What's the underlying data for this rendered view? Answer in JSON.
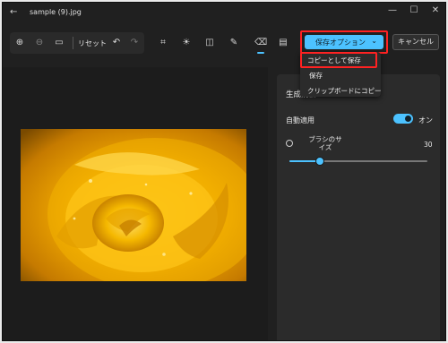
{
  "window": {
    "title": "sample (9).jpg",
    "back_glyph": "←",
    "minimize_glyph": "—",
    "maximize_glyph": "☐",
    "close_glyph": "✕"
  },
  "toolbar": {
    "reset_label": "リセット",
    "zoom_in_glyph": "⊕",
    "zoom_out_glyph": "⊖",
    "fit_glyph": "▭",
    "undo_glyph": "↶",
    "redo_glyph": "↷",
    "crop_glyph": "⌗",
    "adjust_glyph": "☀",
    "filter_glyph": "◫",
    "markup_glyph": "✎",
    "erase_glyph": "⌫",
    "more_glyph": "▤"
  },
  "save": {
    "label": "保存オプション",
    "chevron": "⌄",
    "accent": "#4cc2ff"
  },
  "cancel_label": "キャンセル",
  "save_menu": {
    "items": [
      "コピーとして保存",
      "保存",
      "クリップボードにコピー"
    ]
  },
  "panel": {
    "title": "生成消去",
    "auto_apply_label": "自動適用",
    "toggle_state": "オン",
    "toggle_on": true,
    "brush_label": "ブラシのサイズ",
    "brush_value": "30",
    "brush_slider_fraction": 0.22
  },
  "highlight_color": "#ff2222"
}
